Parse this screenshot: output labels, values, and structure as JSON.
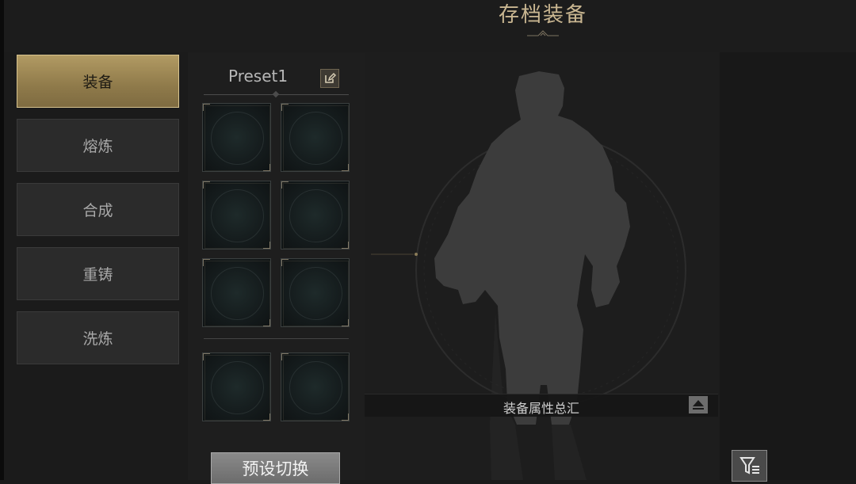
{
  "header": {
    "title": "存档装备"
  },
  "nav": {
    "items": [
      {
        "label": "装备",
        "active": true
      },
      {
        "label": "熔炼",
        "active": false
      },
      {
        "label": "合成",
        "active": false
      },
      {
        "label": "重铸",
        "active": false
      },
      {
        "label": "洗炼",
        "active": false
      }
    ]
  },
  "preset": {
    "name": "Preset1",
    "edit_icon": "edit-icon",
    "switch_label": "预设切换",
    "slot_count": 8
  },
  "summary": {
    "label": "装备属性总汇",
    "toggle_icon": "eject-triangle-icon"
  },
  "filter": {
    "icon": "filter-icon"
  },
  "colors": {
    "accent_gold": "#b19a63",
    "title_gold": "#c9b691",
    "background": "#1a1a1a"
  }
}
